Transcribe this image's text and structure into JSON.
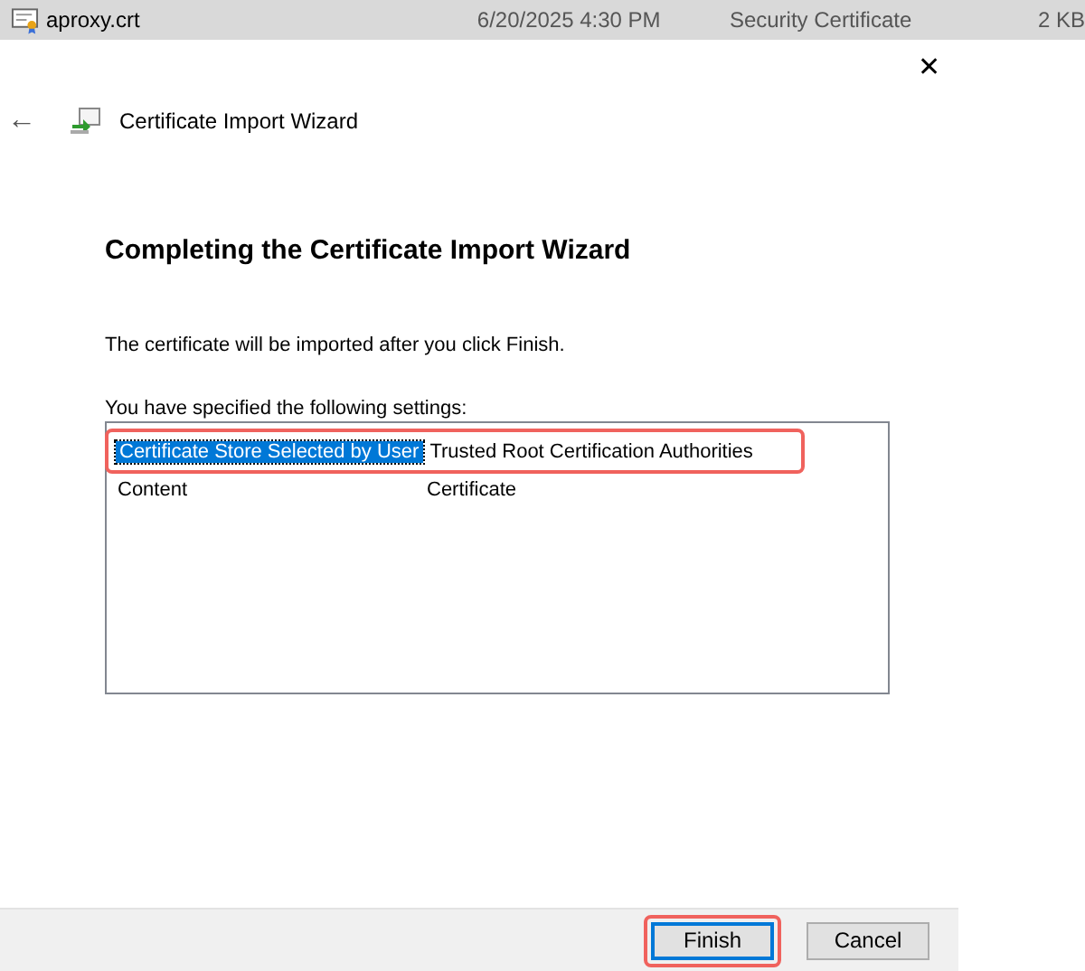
{
  "file_row": {
    "name": "aproxy.crt",
    "date": "6/20/2025 4:30 PM",
    "type": "Security Certificate",
    "size": "2 KB",
    "selected": true
  },
  "window": {
    "title": "Certificate Import Wizard",
    "close": "✕",
    "back": "←"
  },
  "heading": "Completing the Certificate Import Wizard",
  "intro": "The certificate will be imported after you click Finish.",
  "settings_label": "You have specified the following settings:",
  "settings": [
    {
      "name": "Certificate Store Selected by User",
      "value": "Trusted Root Certification Authorities",
      "selected": true,
      "highlighted": true
    },
    {
      "name": "Content",
      "value": "Certificate",
      "selected": false,
      "highlighted": false
    }
  ],
  "buttons": [
    {
      "label": "Finish",
      "default": true,
      "highlighted": true
    },
    {
      "label": "Cancel",
      "default": false,
      "highlighted": false
    }
  ]
}
